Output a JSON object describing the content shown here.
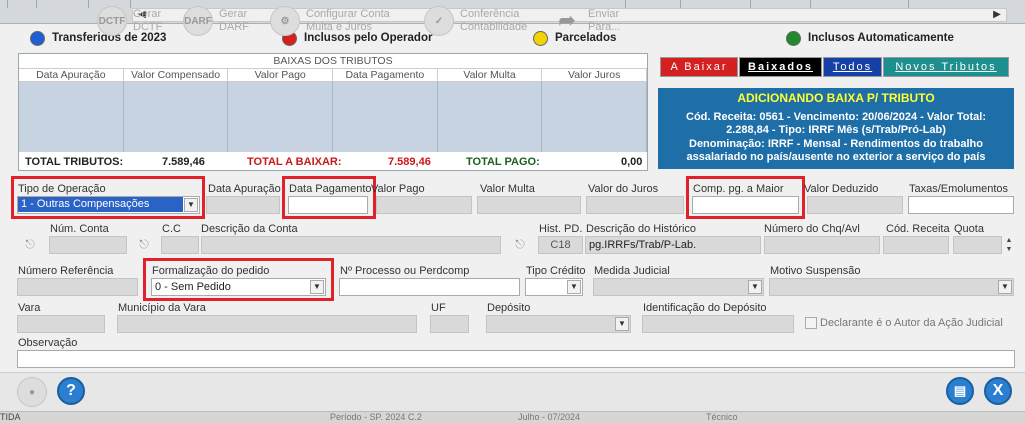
{
  "legend": [
    {
      "label": "Transferidos de 2023",
      "color": "#1e5fd6"
    },
    {
      "label": "Inclusos pelo Operador",
      "color": "#d62020"
    },
    {
      "label": "Parcelados",
      "color": "#f2d200"
    },
    {
      "label": "Inclusos Automaticamente",
      "color": "#1e8a2a"
    }
  ],
  "baixas": {
    "title": "BAIXAS DOS TRIBUTOS",
    "columns": [
      "Data Apuração",
      "Valor Compensado",
      "Valor Pago",
      "Data Pagamento",
      "Valor Multa",
      "Valor Juros"
    ]
  },
  "totals": {
    "tributos_label": "TOTAL TRIBUTOS:",
    "tributos_value": "7.589,46",
    "baixar_label": "TOTAL A BAIXAR:",
    "baixar_value": "7.589,46",
    "pago_label": "TOTAL PAGO:",
    "pago_value": "0,00"
  },
  "tabs": [
    "A Baixar",
    "Baixados",
    "Todos",
    "Novos Tributos"
  ],
  "info": {
    "title": "ADICIONANDO BAIXA P/ TRIBUTO",
    "line1": "Cód. Receita: 0561 - Vencimento: 20/06/2024 - Valor Total:",
    "line2": "2.288,84 - Tipo: IRRF Mês (s/Trab/Pró-Lab)",
    "line3": "Denominação: IRRF - Mensal - Rendimentos do trabalho",
    "line4": "assalariado no país/ausente no exterior a serviço do país"
  },
  "form": {
    "tipo_operacao_label": "Tipo de Operação",
    "tipo_operacao_value": "1 - Outras Compensações",
    "data_apuracao_label": "Data Apuração",
    "data_pagamento_label": "Data Pagamento",
    "valor_pago_label": "Valor Pago",
    "valor_multa_label": "Valor Multa",
    "valor_juros_label": "Valor do Juros",
    "comp_maior_label": "Comp. pg. a Maior",
    "valor_deduzido_label": "Valor Deduzido",
    "taxas_label": "Taxas/Emolumentos",
    "num_conta_label": "Núm. Conta",
    "cc_label": "C.C",
    "descricao_conta_label": "Descrição da Conta",
    "hist_pd_label": "Hist. PD.",
    "hist_pd_value": "C18",
    "descricao_hist_label": "Descrição do Histórico",
    "descricao_hist_value": "pg.IRRFs/Trab/P-Lab.",
    "num_chq_label": "Número do Chq/Avl",
    "cod_receita_label": "Cód. Receita",
    "quota_label": "Quota",
    "num_ref_label": "Número Referência",
    "formalizacao_label": "Formalização do pedido",
    "formalizacao_value": "0 - Sem Pedido",
    "processo_label": "Nº Processo ou Perdcomp",
    "tipo_credito_label": "Tipo Crédito",
    "medida_label": "Medida Judicial",
    "motivo_label": "Motivo Suspensão",
    "vara_label": "Vara",
    "municipio_label": "Município da Vara",
    "uf_label": "UF",
    "deposito_label": "Depósito",
    "ident_deposito_label": "Identificação do Depósito",
    "declarante_label": "Declarante é o Autor da Ação Judicial",
    "observacao_label": "Observação"
  },
  "toolbar": {
    "gerar_dctf": "Gerar\nDCTF",
    "gerar_darf": "Gerar\nDARF",
    "configurar": "Configurar Conta\nMulta e Juros",
    "conferencia": "Conferência\nContabilidade",
    "enviar": "Enviar\nPara..."
  },
  "status": {
    "left": "TIDA",
    "mid1": "Período - SP. 2024 C.2",
    "mid2": "Julho - 07/2024",
    "right": "Técnico"
  }
}
